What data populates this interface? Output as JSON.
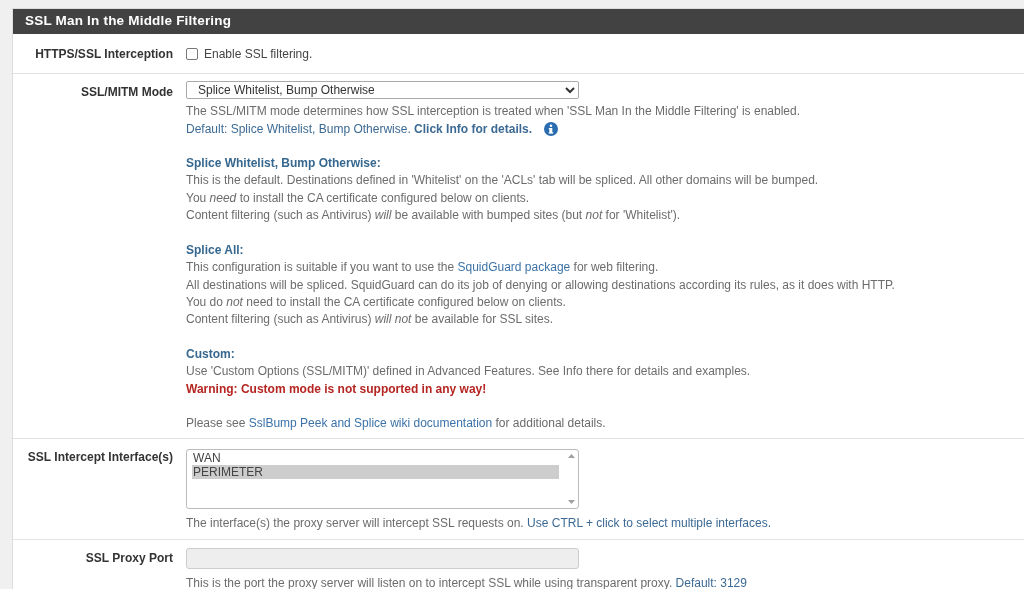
{
  "panel": {
    "title": "SSL Man In the Middle Filtering"
  },
  "rows": [
    {
      "kind": "checkbox",
      "label": "HTTPS/SSL Interception",
      "checkbox": {
        "label": "Enable SSL filtering.",
        "checked": false
      }
    },
    {
      "kind": "select",
      "label": "SSL/MITM Mode",
      "select": {
        "value": "Splice Whitelist, Bump Otherwise"
      },
      "help": [
        {
          "kind": "text",
          "parts": [
            {
              "kind": "text",
              "text": "The SSL/MITM mode determines how SSL interception is treated when 'SSL Man In the Middle Filtering' is enabled."
            }
          ]
        },
        {
          "kind": "info",
          "info_icon": true,
          "parts": [
            {
              "kind": "text",
              "text": "Default: Splice Whitelist, Bump Otherwise. **Click Info for details.**"
            }
          ]
        },
        {
          "kind": "heading",
          "gap": true,
          "parts": [
            {
              "kind": "text",
              "text": "Splice Whitelist, Bump Otherwise:"
            }
          ]
        },
        {
          "kind": "text",
          "parts": [
            {
              "kind": "text",
              "text": "This is the default. Destinations defined in 'Whitelist' on the 'ACLs' tab will be spliced. All other domains will be bumped."
            }
          ]
        },
        {
          "kind": "text",
          "parts": [
            {
              "kind": "text",
              "text": "You *need* to install the CA certificate configured below on clients."
            }
          ]
        },
        {
          "kind": "text",
          "parts": [
            {
              "kind": "text",
              "text": "Content filtering (such as Antivirus) *will* be available with bumped sites (but *not* for 'Whitelist')."
            }
          ]
        },
        {
          "kind": "heading",
          "gap": true,
          "parts": [
            {
              "kind": "text",
              "text": "Splice All:"
            }
          ]
        },
        {
          "kind": "text",
          "parts": [
            {
              "kind": "text",
              "text": "This configuration is suitable if you want to use the "
            },
            {
              "kind": "link",
              "text": "SquidGuard package"
            },
            {
              "kind": "text",
              "text": " for web filtering."
            }
          ]
        },
        {
          "kind": "text",
          "parts": [
            {
              "kind": "text",
              "text": "All destinations will be spliced. SquidGuard can do its job of denying or allowing destinations according its rules, as it does with HTTP."
            }
          ]
        },
        {
          "kind": "text",
          "parts": [
            {
              "kind": "text",
              "text": "You do *not* need to install the CA certificate configured below on clients."
            }
          ]
        },
        {
          "kind": "text",
          "parts": [
            {
              "kind": "text",
              "text": "Content filtering (such as Antivirus) *will not* be available for SSL sites."
            }
          ]
        },
        {
          "kind": "heading",
          "gap": true,
          "parts": [
            {
              "kind": "text",
              "text": "Custom:"
            }
          ]
        },
        {
          "kind": "text",
          "parts": [
            {
              "kind": "text",
              "text": "Use 'Custom Options (SSL/MITM)' defined in Advanced Features. See Info there for details and examples."
            }
          ]
        },
        {
          "kind": "warning",
          "parts": [
            {
              "kind": "text",
              "text": "Warning: Custom mode is not supported in any way!"
            }
          ]
        },
        {
          "kind": "text",
          "gap": true,
          "parts": [
            {
              "kind": "text",
              "text": "Please see "
            },
            {
              "kind": "link",
              "text": "SslBump Peek and Splice wiki documentation"
            },
            {
              "kind": "text",
              "text": " for additional details."
            }
          ]
        }
      ]
    },
    {
      "kind": "listbox",
      "label": "SSL Intercept Interface(s)",
      "options": [
        {
          "label": "WAN",
          "selected": false
        },
        {
          "label": "PERIMETER",
          "selected": true
        }
      ],
      "help": [
        {
          "kind": "text",
          "parts": [
            {
              "kind": "text",
              "text": "The interface(s) the proxy server will intercept SSL requests on. "
            },
            {
              "kind": "info",
              "text": "Use CTRL + click to select multiple interfaces."
            }
          ]
        }
      ]
    },
    {
      "kind": "input",
      "label": "SSL Proxy Port",
      "input": {
        "disabled": true
      },
      "help": [
        {
          "kind": "text",
          "parts": [
            {
              "kind": "text",
              "text": "This is the port the proxy server will listen on to intercept SSL while using transparent proxy. "
            },
            {
              "kind": "info",
              "text": "Default: 3129"
            }
          ]
        }
      ]
    }
  ]
}
